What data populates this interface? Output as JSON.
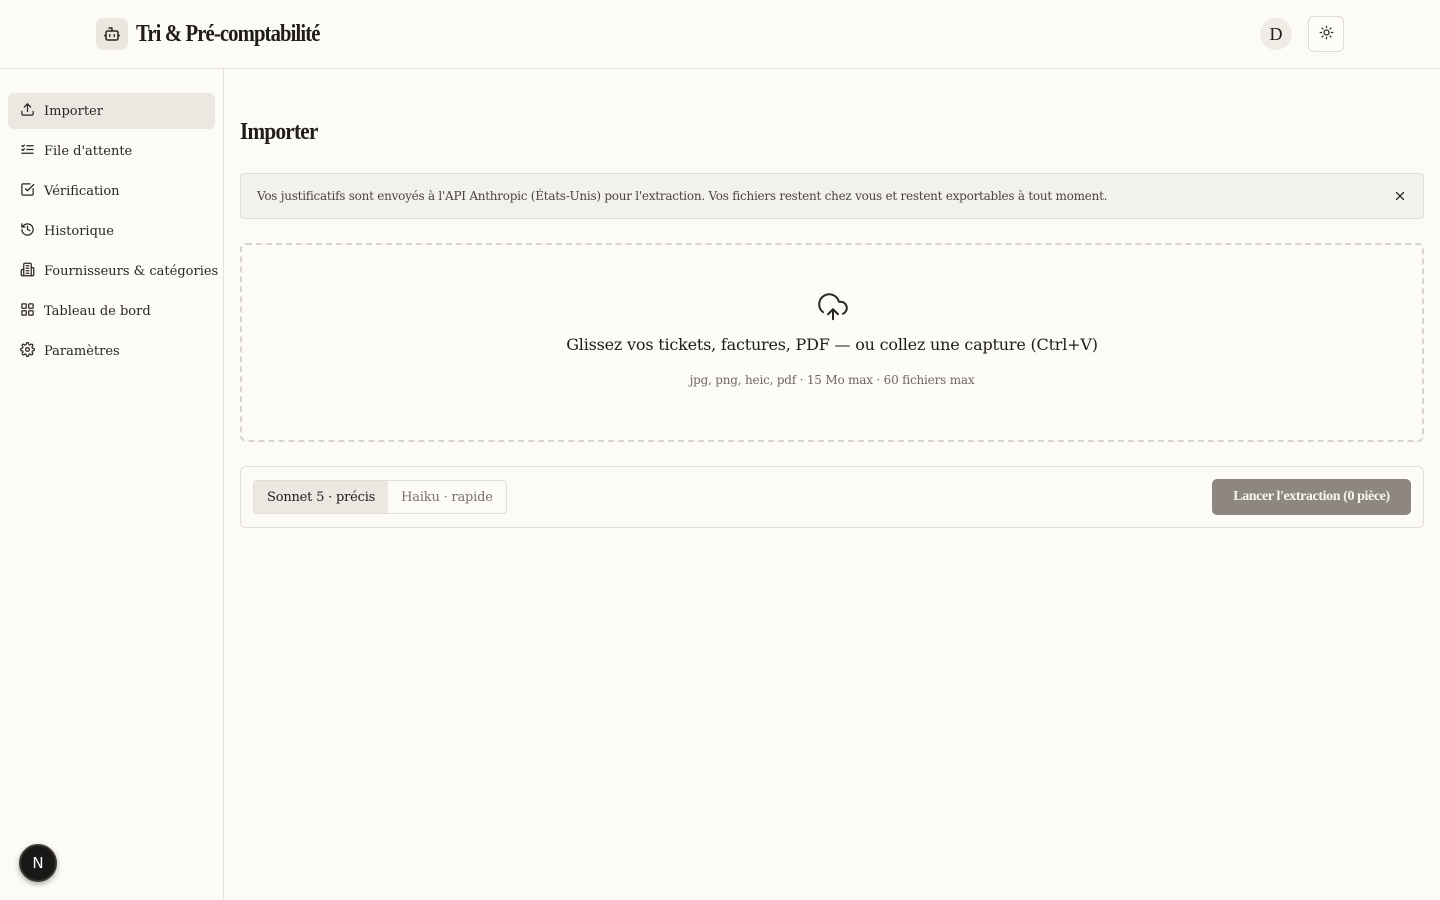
{
  "app": {
    "title": "Tri & Pré-comptabilité",
    "avatar_initial": "D"
  },
  "sidebar": {
    "items": [
      {
        "label": "Importer",
        "icon": "upload-icon",
        "active": true
      },
      {
        "label": "File d'attente",
        "icon": "list-checks-icon"
      },
      {
        "label": "Vérification",
        "icon": "check-square-icon"
      },
      {
        "label": "Historique",
        "icon": "history-icon"
      },
      {
        "label": "Fournisseurs & catégories",
        "icon": "building-icon"
      },
      {
        "label": "Tableau de bord",
        "icon": "dashboard-grid-icon"
      },
      {
        "label": "Paramètres",
        "icon": "gear-icon"
      }
    ],
    "badge": "N"
  },
  "main": {
    "title": "Importer",
    "notice": "Vos justificatifs sont envoyés à l'API Anthropic (États-Unis) pour l'extraction. Vos fichiers restent chez vous et restent exportables à tout moment.",
    "dropzone": {
      "title": "Glissez vos tickets, factures, PDF — ou collez une capture (Ctrl+V)",
      "subtitle": "jpg, png, heic, pdf · 15 Mo max · 60 fichiers max"
    },
    "models": [
      {
        "label": "Sonnet 5 · précis",
        "active": true
      },
      {
        "label": "Haiku · rapide",
        "active": false
      }
    ],
    "extract_label": "Lancer l'extraction (0 pièce)"
  },
  "colors": {
    "accent_disabled": "#8d8780",
    "active_bg": "#ebe8e1",
    "page_bg": "#fcfbf7"
  }
}
